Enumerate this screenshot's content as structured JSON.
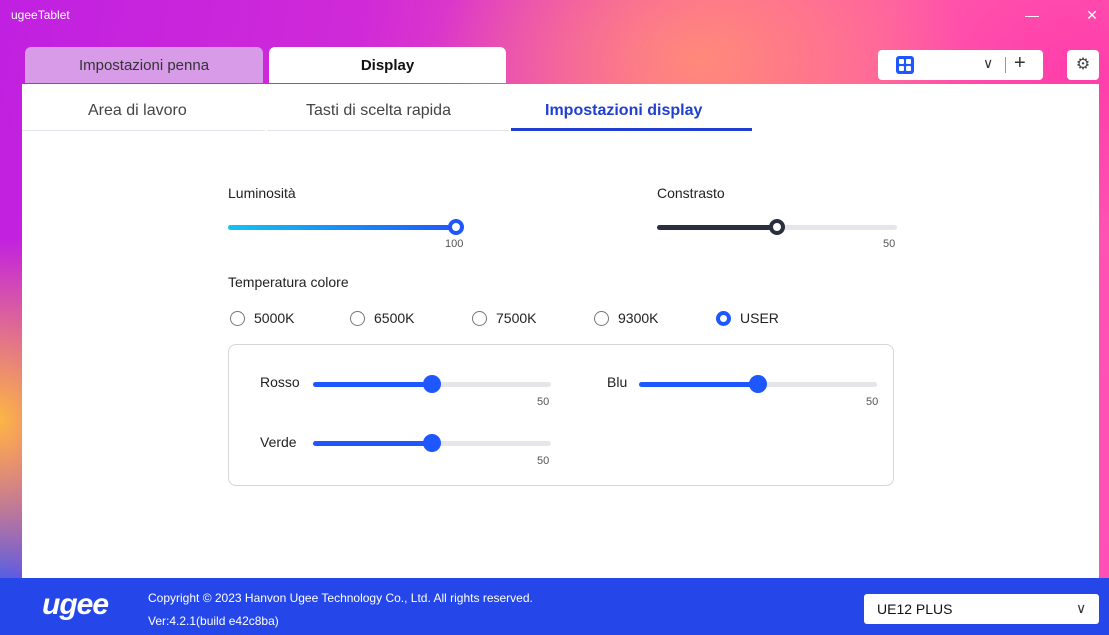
{
  "window": {
    "title": "ugeeTablet",
    "minimize_glyph": "—",
    "close_glyph": "✕"
  },
  "top_tabs": [
    {
      "label": "Impostazioni penna",
      "active": false
    },
    {
      "label": "Display",
      "active": true
    }
  ],
  "toolbar": {
    "app_icon": "grid-icon",
    "chevron": "∨",
    "add": "+",
    "settings_icon": "gear-icon",
    "settings_glyph": "⚙"
  },
  "sub_tabs": [
    {
      "label": "Area di lavoro",
      "active": false
    },
    {
      "label": "Tasti di scelta rapida",
      "active": false
    },
    {
      "label": "Impostazioni display",
      "active": true
    }
  ],
  "brightness": {
    "label": "Luminosità",
    "value": "100",
    "level": 100,
    "max": 100
  },
  "contrast": {
    "label": "Constrasto",
    "value": "50",
    "level": 50,
    "max": 100
  },
  "color_temp": {
    "label": "Temperatura colore",
    "options": [
      "5000K",
      "6500K",
      "7500K",
      "9300K",
      "USER"
    ],
    "selected": "USER"
  },
  "user_rgb": {
    "red": {
      "label": "Rosso",
      "value": "50",
      "level": 50,
      "max": 100
    },
    "blue": {
      "label": "Blu",
      "value": "50",
      "level": 50,
      "max": 100
    },
    "green": {
      "label": "Verde",
      "value": "50",
      "level": 50,
      "max": 100
    }
  },
  "footer": {
    "logo": "ugee",
    "copyright": "Copyright © 2023 Hanvon Ugee Technology Co., Ltd. All rights reserved.",
    "version": "Ver:4.2.1(build e42c8ba)",
    "device": "UE12 PLUS",
    "device_chevron": "∨"
  },
  "colors": {
    "accent": "#1f57ff",
    "tab_active_text": "#1f3fd0",
    "footer_bg": "#2547ea",
    "contrast_fill": "#2a2f3f",
    "brightness_fill_start": "#12c4f0",
    "brightness_fill_end": "#1f57ff"
  }
}
